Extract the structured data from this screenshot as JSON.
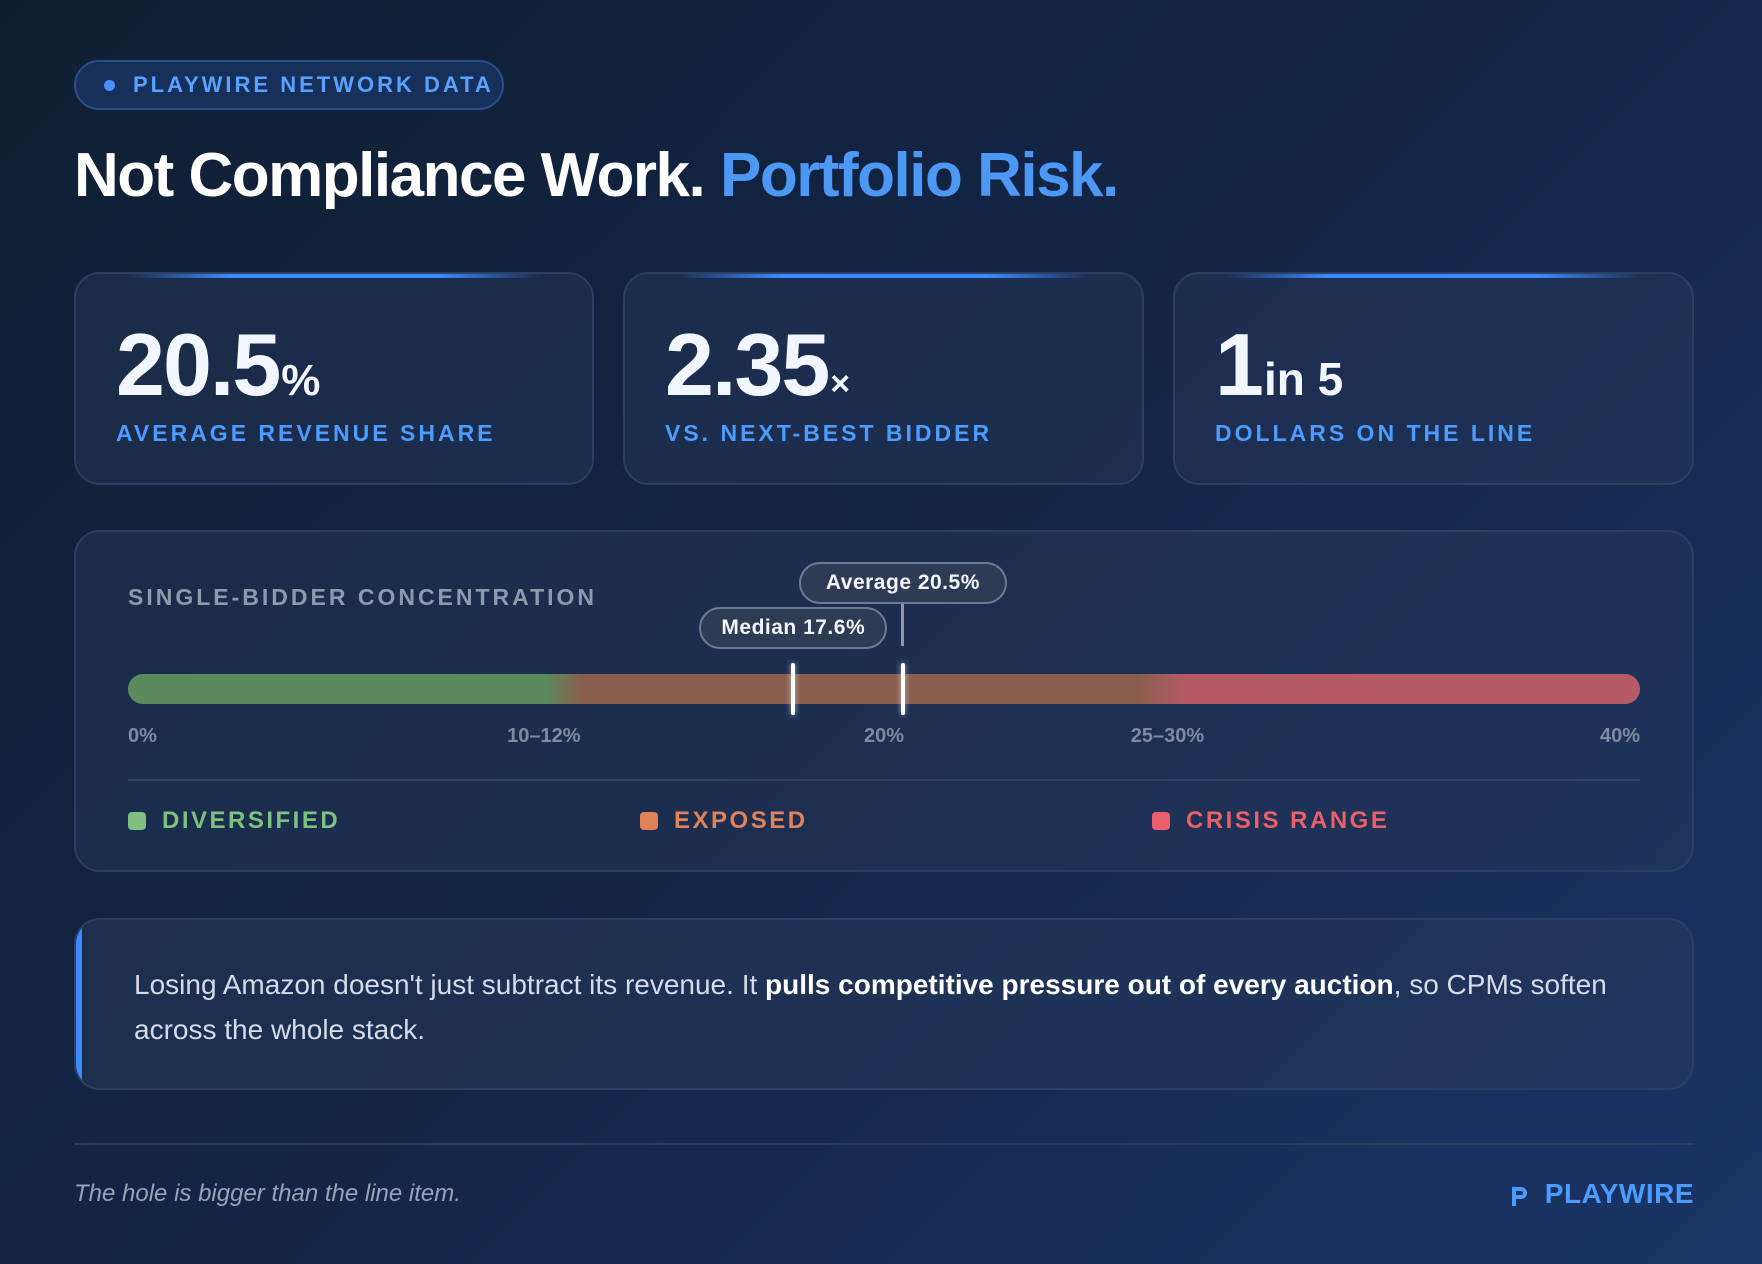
{
  "badge": {
    "label": "PLAYWIRE NETWORK DATA"
  },
  "headline": {
    "part1": "Not Compliance Work.",
    "part2": "Portfolio Risk."
  },
  "stats": [
    {
      "value": "20.5",
      "unit": "%",
      "label": "AVERAGE REVENUE SHARE"
    },
    {
      "value": "2.35",
      "unit": "×",
      "label": "VS. NEXT-BEST BIDDER"
    },
    {
      "value": "1",
      "unit": "in 5",
      "label": "DOLLARS ON THE LINE"
    }
  ],
  "concentration": {
    "title": "SINGLE-BIDDER CONCENTRATION",
    "scale_max": 40,
    "median": {
      "label": "Median 17.6%",
      "value": 17.6
    },
    "average": {
      "label": "Average 20.5%",
      "value": 20.5
    },
    "segments": [
      {
        "name": "diversified",
        "from": 0,
        "to": 12,
        "color": "#5b8a5f"
      },
      {
        "name": "exposed",
        "from": 12,
        "to": 28,
        "color": "#8a5e4e"
      },
      {
        "name": "crisis",
        "from": 28,
        "to": 40,
        "color": "#b55a66"
      }
    ],
    "ticks": [
      {
        "label": "0%",
        "value": 0
      },
      {
        "label": "10–12%",
        "value": 11
      },
      {
        "label": "20%",
        "value": 20
      },
      {
        "label": "25–30%",
        "value": 27.5
      },
      {
        "label": "40%",
        "value": 40
      }
    ],
    "legend": [
      {
        "label": "DIVERSIFIED",
        "color": "#7dc07f"
      },
      {
        "label": "EXPOSED",
        "color": "#e0825a"
      },
      {
        "label": "CRISIS RANGE",
        "color": "#e95f6a"
      }
    ]
  },
  "quote": {
    "text_before": "Losing Amazon doesn't just subtract its revenue. It ",
    "text_bold": "pulls competitive pressure out of every auction",
    "text_after": ", so CPMs soften across the whole stack."
  },
  "footer": {
    "tagline": "The hole is bigger than the line item.",
    "brand": "PLAYWIRE"
  }
}
